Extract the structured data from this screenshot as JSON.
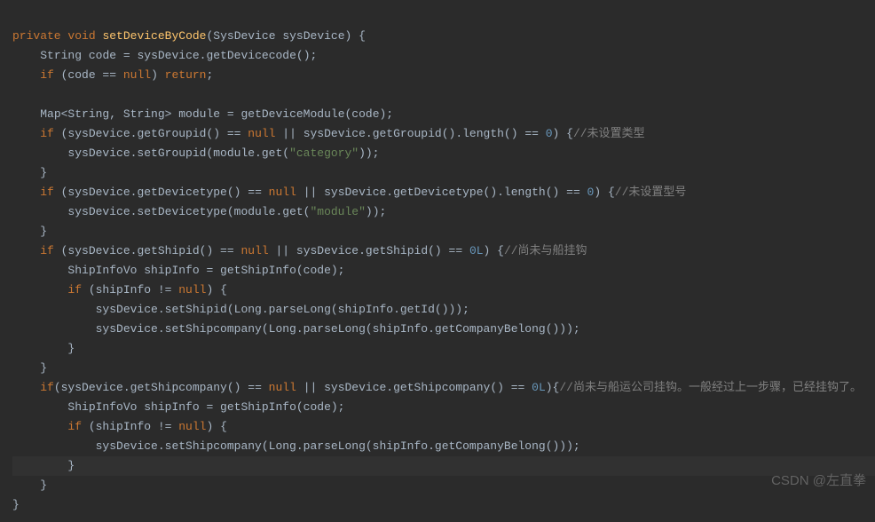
{
  "code": {
    "line1": {
      "kw_private": "private",
      "kw_void": "void",
      "method": "setDeviceByCode",
      "param_type": "SysDevice",
      "param_name": "sysDevice",
      "brace": " {"
    },
    "line2": {
      "type": "String",
      "var": "code",
      "assign": " = sysDevice.getDevicecode();"
    },
    "line3": {
      "kw_if": "if",
      "cond_open": " (code == ",
      "kw_null": "null",
      "cond_close": ") ",
      "kw_return": "return",
      "semi": ";"
    },
    "line4": {
      "blank": ""
    },
    "line5": {
      "maptype": "Map<String",
      "comma": ",",
      "maptype2": " String> module = getDeviceModule(code);"
    },
    "line6": {
      "kw_if": "if",
      "p1": " (sysDevice.getGroupid() == ",
      "kw_null": "null",
      "p2": " || sysDevice.getGroupid().length() == ",
      "num": "0",
      "p3": ") {",
      "comment": "//未设置类型"
    },
    "line7": {
      "p1": "sysDevice.setGroupid(module.get(",
      "str": "\"category\"",
      "p2": "));"
    },
    "line8": {
      "brace": "}"
    },
    "line9": {
      "kw_if": "if",
      "p1": " (sysDevice.getDevicetype() == ",
      "kw_null": "null",
      "p2": " || sysDevice.getDevicetype().length() == ",
      "num": "0",
      "p3": ") {",
      "comment": "//未设置型号"
    },
    "line10": {
      "p1": "sysDevice.setDevicetype(module.get(",
      "str": "\"module\"",
      "p2": "));"
    },
    "line11": {
      "brace": "}"
    },
    "line12": {
      "kw_if": "if",
      "p1": " (sysDevice.getShipid() == ",
      "kw_null": "null",
      "p2": " || sysDevice.getShipid() == ",
      "num": "0L",
      "p3": ") {",
      "comment": "//尚未与船挂钩"
    },
    "line13": {
      "p1": "ShipInfoVo shipInfo = getShipInfo(code);"
    },
    "line14": {
      "kw_if": "if",
      "p1": " (shipInfo != ",
      "kw_null": "null",
      "p2": ") {"
    },
    "line15": {
      "p1": "sysDevice.setShipid(Long.parseLong(shipInfo.getId()));"
    },
    "line16": {
      "p1": "sysDevice.setShipcompany(Long.parseLong(shipInfo.getCompanyBelong()));"
    },
    "line17": {
      "brace": "}"
    },
    "line18": {
      "brace": "}"
    },
    "line19": {
      "kw_if": "if",
      "p1": "(sysDevice.getShipcompany() == ",
      "kw_null": "null",
      "p2": " || sysDevice.getShipcompany() == ",
      "num": "0L",
      "p3": "){",
      "comment": "//尚未与船运公司挂钩。一般经过上一步骤，已经挂钩了。"
    },
    "line20": {
      "p1": "ShipInfoVo shipInfo = getShipInfo(code);"
    },
    "line21": {
      "kw_if": "if",
      "p1": " (shipInfo != ",
      "kw_null": "null",
      "p2": ") {"
    },
    "line22": {
      "p1": "sysDevice.setShipcompany(Long.parseLong(shipInfo.getCompanyBelong()));"
    },
    "line23": {
      "brace": "}"
    },
    "line24": {
      "brace": "}"
    },
    "line25": {
      "brace": "}"
    }
  },
  "watermark": "CSDN @左直拳"
}
